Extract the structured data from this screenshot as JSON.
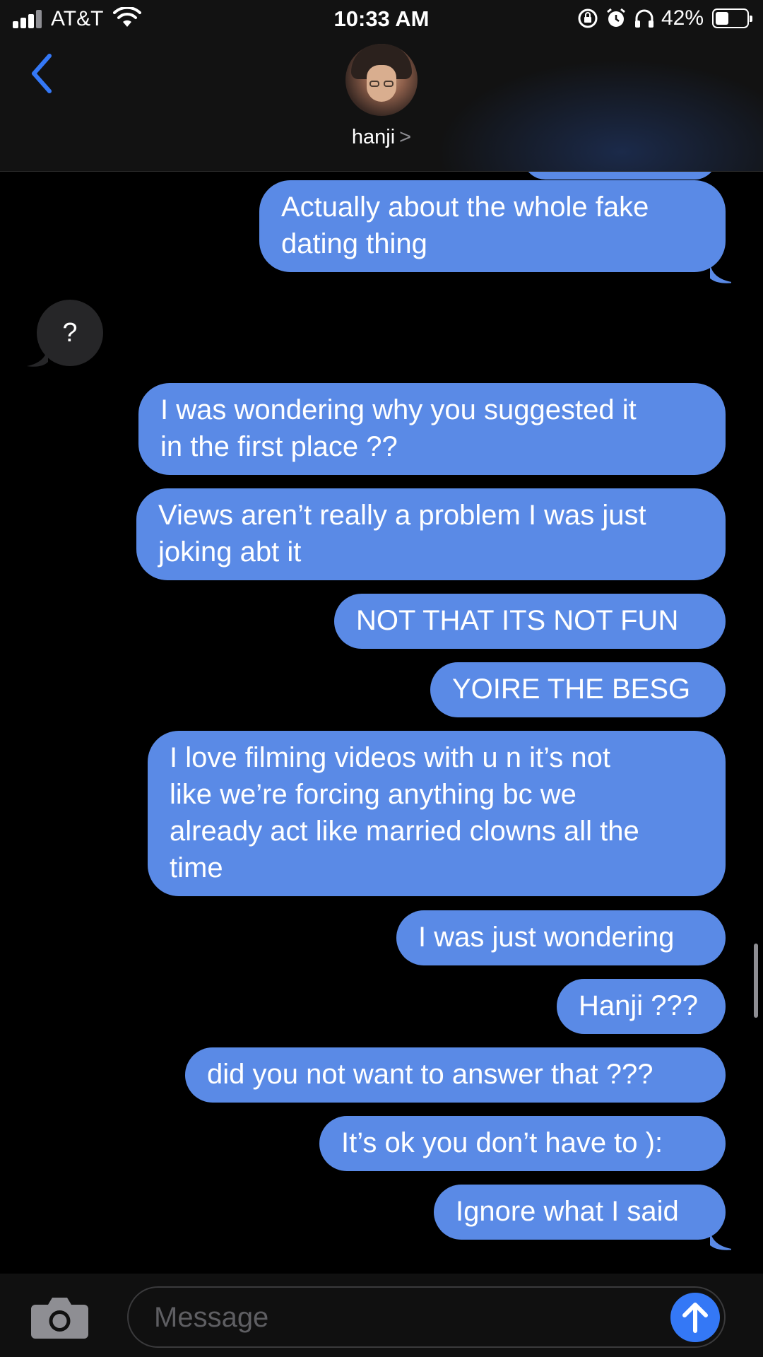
{
  "status_bar": {
    "carrier": "AT&T",
    "time": "10:33 AM",
    "battery_percent": "42%",
    "battery_level": 0.42,
    "icons": [
      "signal-icon",
      "wifi-icon",
      "rotation-lock-icon",
      "alarm-icon",
      "headphones-icon",
      "battery-icon"
    ]
  },
  "header": {
    "back_icon": "chevron-left-icon",
    "contact_name": "hanji",
    "contact_chevron": ">"
  },
  "messages": [
    {
      "from": "me",
      "lines": [
        "Actually about the whole fake",
        "dating thing"
      ]
    },
    {
      "from": "them",
      "lines": [
        "?"
      ]
    },
    {
      "from": "me",
      "lines": [
        "I was wondering why you suggested it",
        "in the first place ??"
      ]
    },
    {
      "from": "me",
      "lines": [
        "Views aren’t really a problem I was just",
        "joking abt it"
      ]
    },
    {
      "from": "me",
      "lines": [
        "NOT THAT ITS NOT FUN"
      ]
    },
    {
      "from": "me",
      "lines": [
        "YOIRE THE BESG"
      ]
    },
    {
      "from": "me",
      "lines": [
        "I love filming videos with u n it’s not",
        "like we’re forcing anything bc we",
        "already act like married clowns all the",
        "time"
      ]
    },
    {
      "from": "me",
      "lines": [
        "I was just wondering"
      ]
    },
    {
      "from": "me",
      "lines": [
        "Hanji ???"
      ]
    },
    {
      "from": "me",
      "lines": [
        "did you not want to answer that ???"
      ]
    },
    {
      "from": "me",
      "lines": [
        "It’s ok you don’t have to ):"
      ]
    },
    {
      "from": "me",
      "lines": [
        "Ignore what I said"
      ]
    }
  ],
  "composer": {
    "placeholder": "Message",
    "camera_icon": "camera-icon",
    "send_icon": "arrow-up-icon"
  },
  "colors": {
    "outgoing_bubble": "#5a8ae6",
    "incoming_bubble": "#262628",
    "accent": "#3478f6",
    "background": "#000000"
  }
}
